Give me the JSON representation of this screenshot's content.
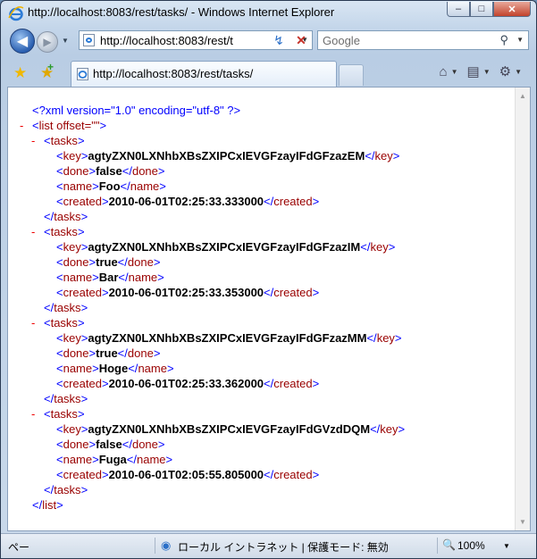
{
  "window": {
    "title": "http://localhost:8083/rest/tasks/ - Windows Internet Explorer",
    "minimize_glyph": "–",
    "maximize_glyph": "□",
    "close_glyph": "✕"
  },
  "address_bar": {
    "url": "http://localhost:8083/rest/t",
    "back_glyph": "◀",
    "forward_glyph": "▶",
    "refresh_glyph": "↯",
    "stop_glyph": "✕"
  },
  "search": {
    "placeholder": "Google",
    "icon": "search-icon"
  },
  "tab": {
    "label": "http://localhost:8083/rest/tasks/"
  },
  "toolbar_icons": [
    "home-icon",
    "page-icon",
    "tools-gear-icon"
  ],
  "xml": {
    "declaration": "<?xml version=\"1.0\" encoding=\"utf-8\" ?>",
    "root_tag": "list",
    "root_attr": "offset=\"\"",
    "item_tag": "tasks",
    "tasks": [
      {
        "key": "agtyZXN0LXNhbXBsZXIPCxIEVGFzayIFdGFzazEM",
        "done": "false",
        "name": "Foo",
        "created": "2010-06-01T02:25:33.333000"
      },
      {
        "key": "agtyZXN0LXNhbXBsZXIPCxIEVGFzayIFdGFzazIM",
        "done": "true",
        "name": "Bar",
        "created": "2010-06-01T02:25:33.353000"
      },
      {
        "key": "agtyZXN0LXNhbXBsZXIPCxIEVGFzayIFdGFzazMM",
        "done": "true",
        "name": "Hoge",
        "created": "2010-06-01T02:25:33.362000"
      },
      {
        "key": "agtyZXN0LXNhbXBsZXIPCxIEVGFzayIFdGVzdDQM",
        "done": "false",
        "name": "Fuga",
        "created": "2010-06-01T02:05:55.805000"
      }
    ]
  },
  "status_bar": {
    "left_text": "ペー",
    "zone": "ローカル イントラネット | 保護モード: 無効",
    "zoom": "100%"
  }
}
